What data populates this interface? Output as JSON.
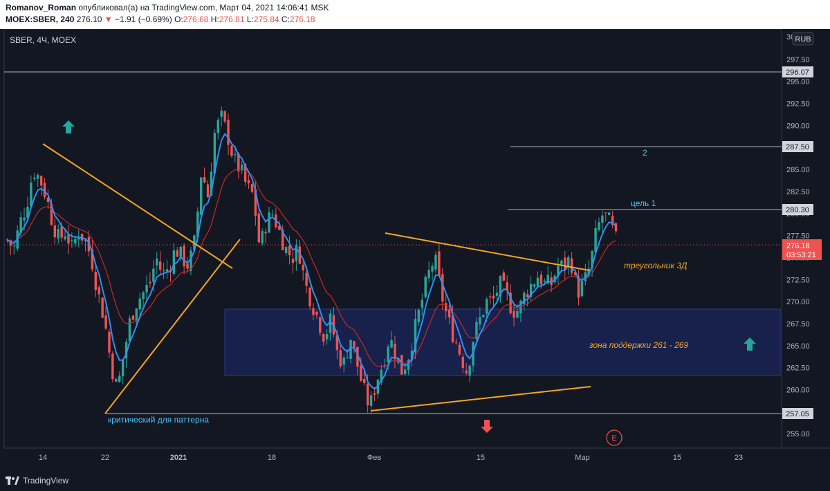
{
  "header": {
    "author": "Romanov_Roman",
    "published_text": "опубликовал(а) на TradingView.com, Март 04, 2021 14:06:41 MSK",
    "symbol": "MOEX:SBER, 240",
    "last": "276.10",
    "change": "−1.91 (−0.69%)",
    "open_label": "O:",
    "open": "276.68",
    "high_label": "H:",
    "high": "276.81",
    "low_label": "L:",
    "low": "275.84",
    "close_label": "C:",
    "close": "276.18"
  },
  "chart": {
    "legend": "SBER, 4Ч, MOEX",
    "currency": "RUB",
    "price_ticks": [
      "297.50",
      "295.00",
      "292.50",
      "290.00",
      "287.50",
      "285.00",
      "282.50",
      "280.00",
      "277.50",
      "275.00",
      "272.50",
      "270.00",
      "267.50",
      "265.00",
      "262.50",
      "260.00",
      "257.50",
      "255.00"
    ],
    "top_tick_partial": "30",
    "time_ticks": [
      "14",
      "22",
      "2021",
      "18",
      "Фев",
      "15",
      "Мар",
      "15",
      "23"
    ],
    "level_labels": [
      "296.07",
      "287.50",
      "280.30",
      "257.05"
    ],
    "last_price": "276.18",
    "countdown": "03:53:21",
    "annotations": {
      "target2": "2",
      "target1": "цель 1",
      "triangle": "треугольник 3Д",
      "support_zone": "зона поддержки 261 - 269",
      "critical": "критический для паттерна",
      "earnings": "E"
    },
    "colors": {
      "up": "#26a69a",
      "down": "#ef5350",
      "ema_fast": "#2f8ff5",
      "ema_slow": "#c62828",
      "trend": "#f5a623",
      "zone": "#1e2a6e",
      "level": "#b2b5be"
    }
  },
  "chart_data": {
    "type": "candlestick",
    "symbol": "MOEX:SBER",
    "timeframe": "240",
    "ylim": [
      253,
      300
    ],
    "levels": [
      296.07,
      287.5,
      280.3,
      257.05
    ],
    "support_zone": [
      261.5,
      269
    ],
    "last": 276.18,
    "price_path": [
      277,
      276,
      279,
      281,
      285,
      284,
      282,
      279,
      277,
      278,
      276,
      278,
      277,
      275,
      271,
      268,
      263,
      260,
      264,
      268,
      270,
      271,
      272,
      275,
      273,
      274,
      276,
      275,
      274,
      277,
      285,
      282,
      289,
      291,
      289,
      286,
      285,
      283,
      282,
      276,
      279,
      280,
      278,
      276,
      275,
      276,
      272,
      270,
      268,
      266,
      268,
      264,
      263,
      266,
      263,
      260,
      258,
      261,
      263,
      266,
      264,
      262,
      264,
      267,
      270,
      273,
      275,
      271,
      268,
      266,
      264,
      262,
      266,
      268,
      270,
      270,
      272,
      271,
      269,
      269,
      271,
      272,
      273,
      272,
      272,
      274,
      274,
      275,
      271,
      272,
      274,
      278,
      280,
      279,
      277
    ]
  },
  "footer": {
    "brand": "TradingView"
  }
}
